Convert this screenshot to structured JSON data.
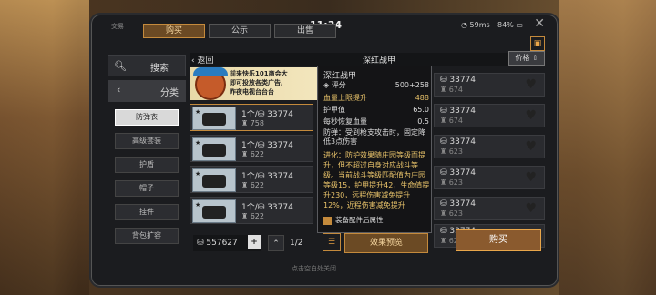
{
  "status": {
    "app": "交易",
    "time": "11:34",
    "network": "59ms",
    "battery": "84%"
  },
  "tabs": [
    {
      "label": "购买"
    },
    {
      "label": "公示"
    },
    {
      "label": "出售"
    }
  ],
  "sidebar": {
    "search": "搜索",
    "category": "分类",
    "items": [
      "防弹衣",
      "高级套装",
      "护盾",
      "帽子",
      "挂件",
      "背包扩容"
    ]
  },
  "breadcrumb": {
    "back": "返回",
    "title": "深红战甲",
    "sort": "价格"
  },
  "banner": {
    "line1": "前来快乐101商会大",
    "line2": "即可投放各类广告,",
    "line3": "昨夜电视台台台"
  },
  "items": [
    {
      "qty": "1个/",
      "price": "33774",
      "score": "758"
    },
    {
      "qty": "1个/",
      "price": "33774",
      "score": "622"
    },
    {
      "qty": "1个/",
      "price": "33774",
      "score": "622"
    },
    {
      "qty": "1个/",
      "price": "33774",
      "score": "622"
    }
  ],
  "right_items": [
    {
      "price": "33774",
      "score": "674"
    },
    {
      "price": "33774",
      "score": "674"
    },
    {
      "price": "33774",
      "score": "623"
    },
    {
      "price": "33774",
      "score": "623"
    },
    {
      "price": "33774",
      "score": "623"
    },
    {
      "price": "33774",
      "score": "622"
    }
  ],
  "tooltip": {
    "name": "深红战甲",
    "score_label": "评分",
    "score_value": "500+258",
    "hp_label": "血量上限提升",
    "hp_value": "488",
    "armor_label": "护甲值",
    "armor_value": "65.0",
    "regen_label": "每秒恢复血量",
    "regen_value": "0.5",
    "effect": "防弹：受到枪支攻击时，固定降低3点伤害",
    "advance": "进化：防护效果随庄园等级而提升，但不超过自身对应战斗等级。当前战斗等级匹配值为庄园等级15，护甲提升42，生命值提升230，远程伤害减免提升12%，近程伤害减免提升",
    "checkbox": "装备配件后属性"
  },
  "bottom": {
    "wallet": "557627",
    "page": "1/2",
    "preview": "效果预览",
    "buy": "购买"
  },
  "hint": "点击空白处关闭"
}
